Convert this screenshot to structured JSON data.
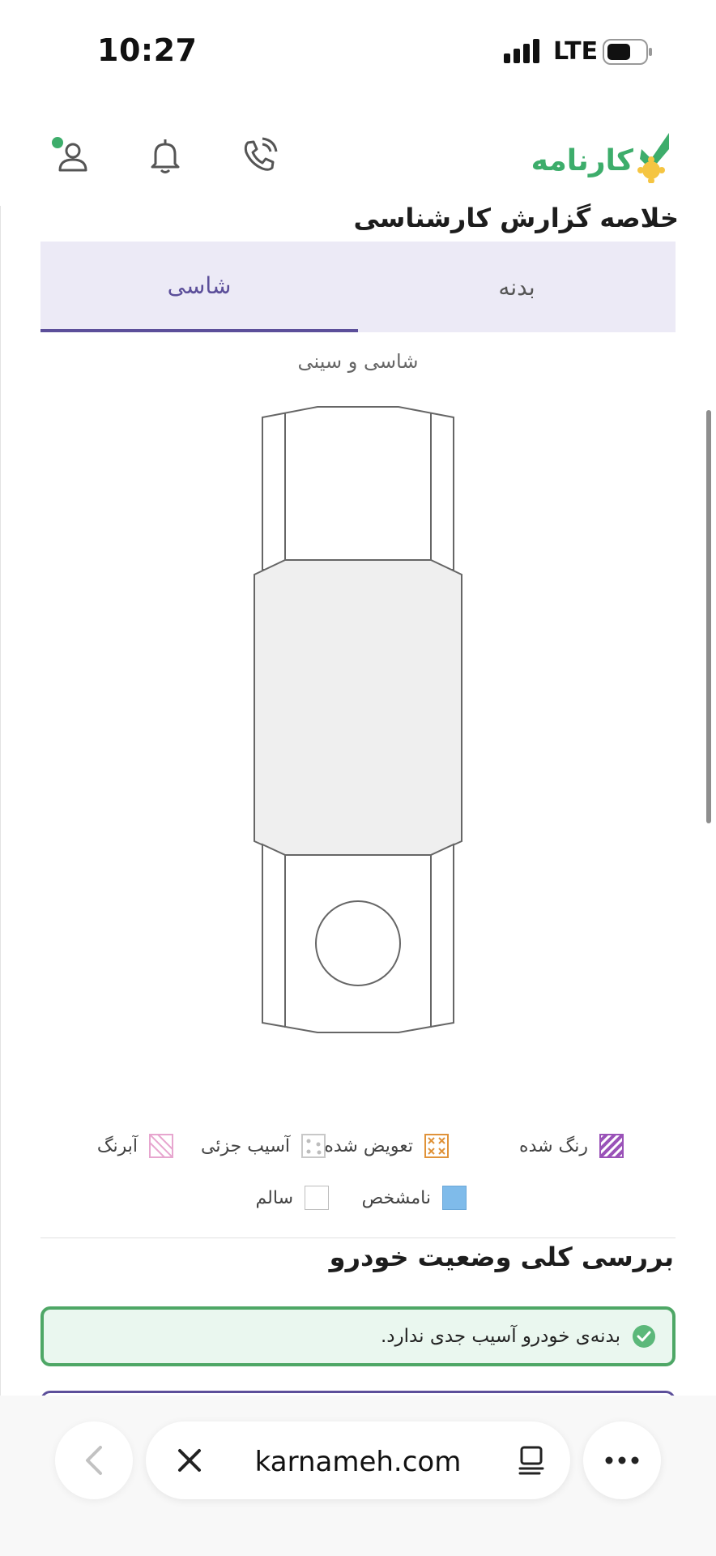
{
  "status_bar": {
    "time": "10:27",
    "network": "LTE"
  },
  "header": {
    "logo_text": "کارنامه",
    "icons": [
      "account-icon",
      "bell-icon",
      "phone-icon"
    ],
    "brand_color": "#3dad6b"
  },
  "summary": {
    "title": "خلاصه گزارش کارشناسی",
    "tabs": [
      {
        "label": "بدنه",
        "active": false
      },
      {
        "label": "شاسی",
        "active": true
      }
    ],
    "diagram_caption": "شاسی و سینی",
    "accent": "#5c4f9a"
  },
  "legend": {
    "painted": "رنگ شده",
    "replaced": "تعویض شده",
    "partial_damage": "آسیب جزئی",
    "aberang": "آبرنگ",
    "unknown": "نامشخص",
    "healthy": "سالم"
  },
  "overview": {
    "title": "بررسی کلی وضعیت خودرو",
    "status_text": "بدنه‌ی خودرو آسیب جدی ندارد.",
    "status_color": "#4ea766"
  },
  "browser": {
    "url": "karnameh.com"
  }
}
